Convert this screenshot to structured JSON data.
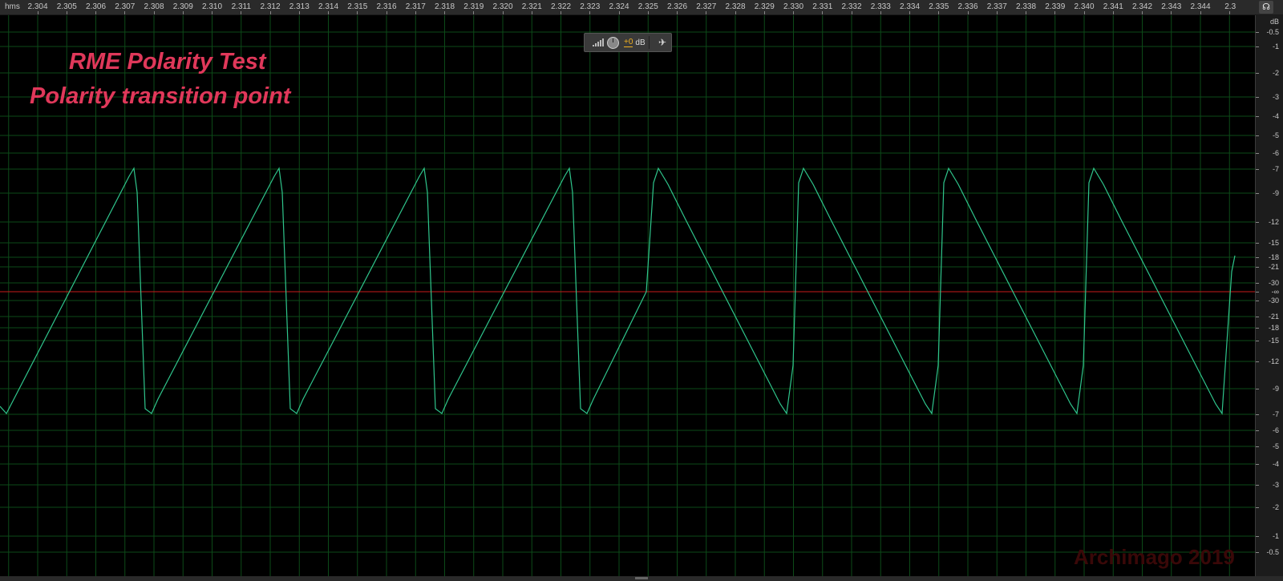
{
  "ruler": {
    "unit": "hms",
    "labels": [
      "2.304",
      "2.305",
      "2.306",
      "2.307",
      "2.308",
      "2.309",
      "2.310",
      "2.311",
      "2.312",
      "2.313",
      "2.314",
      "2.315",
      "2.316",
      "2.317",
      "2.318",
      "2.319",
      "2.320",
      "2.321",
      "2.322",
      "2.323",
      "2.324",
      "2.325",
      "2.326",
      "2.327",
      "2.328",
      "2.329",
      "2.330",
      "2.331",
      "2.332",
      "2.333",
      "2.334",
      "2.335",
      "2.336",
      "2.337",
      "2.338",
      "2.339",
      "2.340",
      "2.341",
      "2.342",
      "2.343",
      "2.344",
      "2.3"
    ]
  },
  "db_scale": {
    "unit": "dB",
    "upper": [
      "-0.5",
      "-1",
      "-2",
      "-3",
      "-4",
      "-5",
      "-6",
      "-7",
      "-9",
      "-12",
      "-15",
      "-18",
      "-21",
      "-30"
    ],
    "center": "-∞",
    "lower": [
      "-30",
      "-21",
      "-18",
      "-15",
      "-12",
      "-9",
      "-7",
      "-6",
      "-5",
      "-4",
      "-3",
      "-2",
      "-1",
      "-0.5"
    ]
  },
  "hud": {
    "gain_value": "+0",
    "gain_unit": "dB",
    "pin_icon": "pin-icon",
    "knob_icon": "volume-knob-icon",
    "bars_icon": "signal-bars-icon"
  },
  "overlay": {
    "title_line1": "RME Polarity Test",
    "title_line2": "Polarity transition point",
    "watermark": "Archimago 2019"
  },
  "colors": {
    "waveform": "#2fc58c",
    "grid": "#0c4a18",
    "centerline": "#c81a1a",
    "title": "#e0385a"
  }
}
